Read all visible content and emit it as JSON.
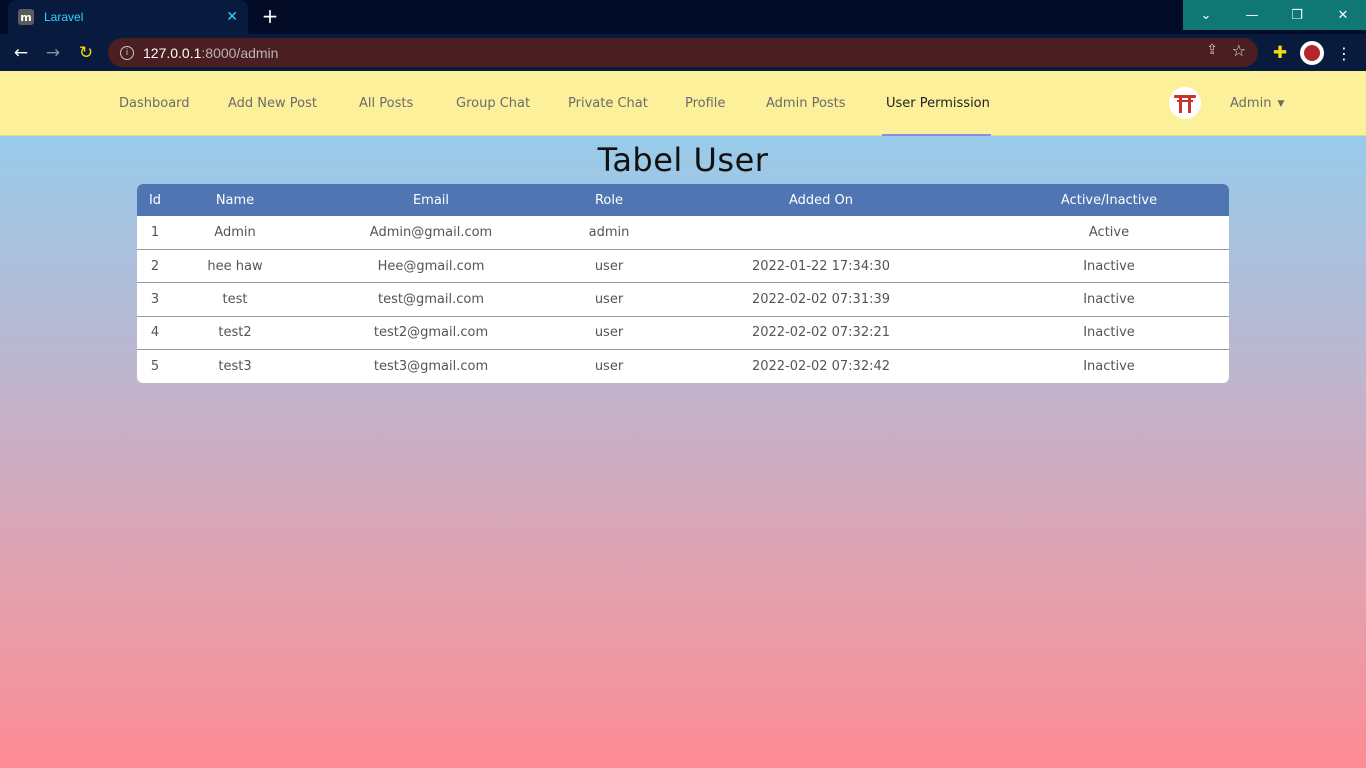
{
  "browser": {
    "tab_title": "Laravel",
    "tab_favicon": "m",
    "new_tab_symbol": "+",
    "url_host": "127.0.0.1",
    "url_rest": ":8000/admin"
  },
  "nav": {
    "items": [
      {
        "label": "Dashboard"
      },
      {
        "label": "Add New Post"
      },
      {
        "label": "All Posts"
      },
      {
        "label": "Group Chat"
      },
      {
        "label": "Private Chat"
      },
      {
        "label": "Profile"
      },
      {
        "label": "Admin Posts"
      },
      {
        "label": "User Permission",
        "active": true
      }
    ],
    "user_label": "Admin"
  },
  "page": {
    "title": "Tabel User"
  },
  "table": {
    "headers": {
      "id": "Id",
      "name": "Name",
      "email": "Email",
      "role": "Role",
      "added": "Added On",
      "active": "Active/Inactive"
    },
    "rows": [
      {
        "id": "1",
        "name": "Admin",
        "email": "Admin@gmail.com",
        "role": "admin",
        "added": "",
        "status": "Active"
      },
      {
        "id": "2",
        "name": "hee haw",
        "email": "Hee@gmail.com",
        "role": "user",
        "added": "2022-01-22 17:34:30",
        "status": "Inactive"
      },
      {
        "id": "3",
        "name": "test",
        "email": "test@gmail.com",
        "role": "user",
        "added": "2022-02-02 07:31:39",
        "status": "Inactive"
      },
      {
        "id": "4",
        "name": "test2",
        "email": "test2@gmail.com",
        "role": "user",
        "added": "2022-02-02 07:32:21",
        "status": "Inactive"
      },
      {
        "id": "5",
        "name": "test3",
        "email": "test3@gmail.com",
        "role": "user",
        "added": "2022-02-02 07:32:42",
        "status": "Inactive"
      }
    ]
  },
  "colors": {
    "navbar_bg": "#fdf09b",
    "table_header_bg": "#4f75b3",
    "active_underline": "#8b8ce3"
  }
}
